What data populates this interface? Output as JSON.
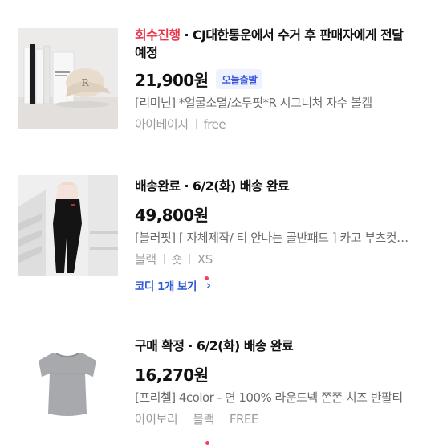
{
  "orders": [
    {
      "status_highlight": "회수진행",
      "status_rest": " · CJ대한통운에서 수거 후 판매자에게 전달 예정",
      "price": "21,900원",
      "badge": "오늘출발",
      "title": "[리미닌] *얼굴소멸/소두핏*R 시그니처 자수 볼캡",
      "options": [
        "아이베이지",
        "free"
      ],
      "thumb": {
        "icon": "cap-photo",
        "logo_letter": "R"
      }
    },
    {
      "status": "배송완료 · 6/2(화) 배송 완료",
      "price": "49,800원",
      "title": "[블러핏] [ 자체제작/ 티 안나는 골반패드 ] 카고 부츠컷 팬츠",
      "options": [
        "블랙",
        "숏",
        "XS"
      ],
      "coordi_label": "코디 1개 보기",
      "thumb": {
        "icon": "pants-photo"
      }
    },
    {
      "status": "구매 확정 · 6/2(화) 배송 완료",
      "price": "16,270원",
      "title": "[프리첼] 4color - 면 100% 라운드넥 쫀쫀 치즈 반팔티",
      "options": [
        "아이보리",
        "블랙",
        "FREE"
      ],
      "thumb": {
        "icon": "tshirt-photo"
      }
    }
  ],
  "colors": {
    "accent_red": "#e8364a",
    "link_blue": "#2f5bd8",
    "badge_blue": "#3a55e0"
  }
}
